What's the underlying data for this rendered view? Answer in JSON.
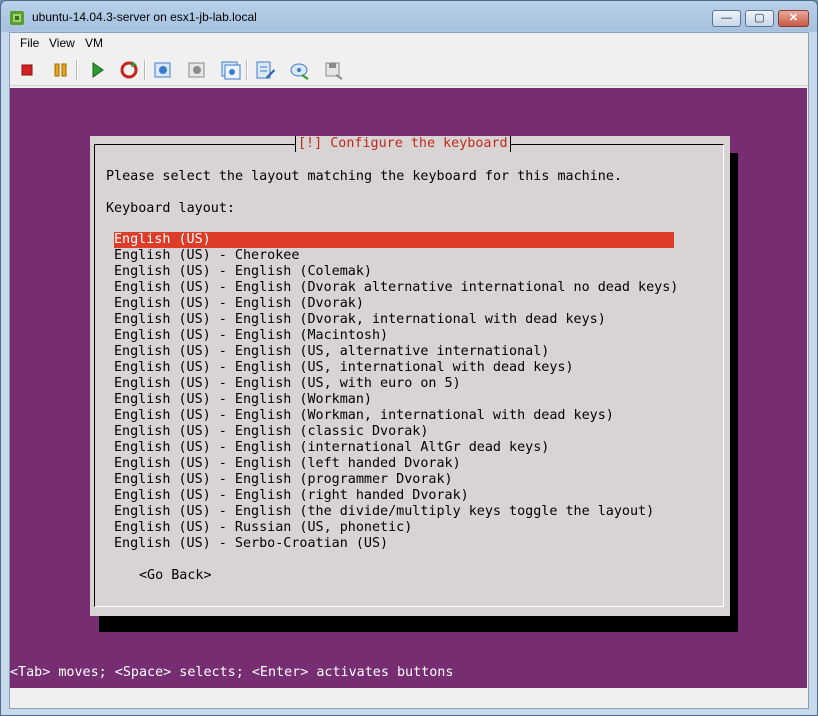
{
  "window": {
    "title": "ubuntu-14.04.3-server on esx1-jb-lab.local",
    "controls": {
      "minimize": "—",
      "maximize": "▢",
      "close": "✕"
    }
  },
  "menubar": {
    "items": [
      {
        "label": "File"
      },
      {
        "label": "View"
      },
      {
        "label": "VM"
      }
    ]
  },
  "toolbar": {
    "buttons": [
      {
        "name": "power-off-icon",
        "color": "#d42222"
      },
      {
        "name": "suspend-icon",
        "color": "#e8a617"
      },
      {
        "name": "power-on-icon",
        "color": "#2a9d2a"
      },
      {
        "name": "reset-icon",
        "color": "#c8231f"
      },
      {
        "name": "snapshot-icon",
        "color": "#3c7bd0"
      },
      {
        "name": "revert-snapshot-icon",
        "color": "#8a8a8a"
      },
      {
        "name": "snapshot-manager-icon",
        "color": "#3c7bd0"
      },
      {
        "name": "edit-settings-icon",
        "color": "#3c7bd0"
      },
      {
        "name": "connect-cdrom-icon",
        "color": "#3c7bd0"
      },
      {
        "name": "connect-floppy-icon",
        "color": "#8a8a8a"
      }
    ]
  },
  "console": {
    "background": "#772d72",
    "dialog": {
      "title": "[!] Configure the keyboard",
      "prompt": "Please select the layout matching the keyboard for this machine.",
      "list_label": "Keyboard layout:",
      "selected_index": 0,
      "layouts": [
        "English (US)",
        "English (US) - Cherokee",
        "English (US) - English (Colemak)",
        "English (US) - English (Dvorak alternative international no dead keys)",
        "English (US) - English (Dvorak)",
        "English (US) - English (Dvorak, international with dead keys)",
        "English (US) - English (Macintosh)",
        "English (US) - English (US, alternative international)",
        "English (US) - English (US, international with dead keys)",
        "English (US) - English (US, with euro on 5)",
        "English (US) - English (Workman)",
        "English (US) - English (Workman, international with dead keys)",
        "English (US) - English (classic Dvorak)",
        "English (US) - English (international AltGr dead keys)",
        "English (US) - English (left handed Dvorak)",
        "English (US) - English (programmer Dvorak)",
        "English (US) - English (right handed Dvorak)",
        "English (US) - English (the divide/multiply keys toggle the layout)",
        "English (US) - Russian (US, phonetic)",
        "English (US) - Serbo-Croatian (US)"
      ],
      "go_back": "<Go Back>"
    },
    "status_line": "<Tab> moves; <Space> selects; <Enter> activates buttons"
  }
}
